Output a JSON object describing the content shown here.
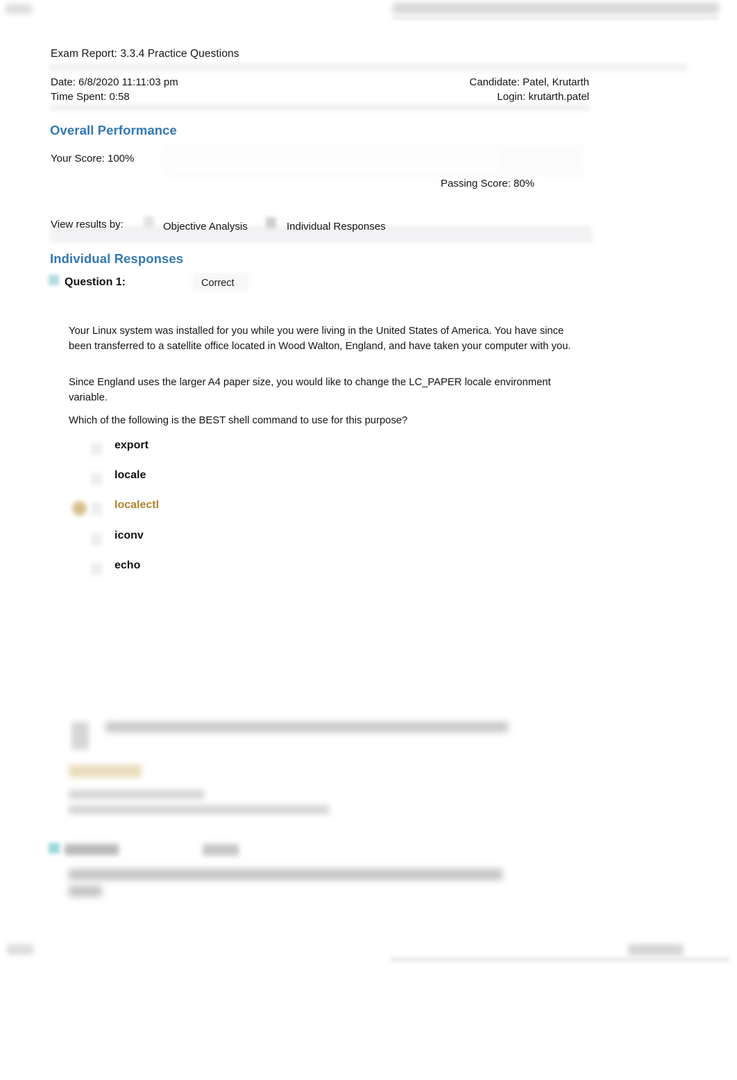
{
  "document": {
    "title": "Exam Report: 3.3.4 Practice Questions"
  },
  "meta": {
    "date_label": "Date: 6/8/2020 11:11:03 pm",
    "time_spent_label": "Time Spent: 0:58",
    "candidate_label": "Candidate: Patel, Krutarth",
    "login_label": "Login: krutarth.patel"
  },
  "overall_performance": {
    "heading": "Overall Performance",
    "your_score_label": "Your Score:  100%",
    "your_score_value": "100%",
    "passing_score_label": "Passing Score:  80%",
    "passing_score_value": "80%"
  },
  "view_results": {
    "label": "View results by:",
    "options": [
      {
        "label": "Objective Analysis",
        "selected": false
      },
      {
        "label": "Individual Responses",
        "selected": true
      }
    ]
  },
  "individual_responses": {
    "heading": "Individual Responses",
    "question": {
      "number_label": "Question 1:",
      "status_label": "Correct",
      "paragraphs": [
        "Your Linux system was installed for you while you were living in the United States of America. You have since been transferred to a satellite office located in Wood Walton, England, and have taken your computer with you.",
        "Since England uses the larger A4 paper size, you would like to change the LC_PAPER locale environment variable.",
        "Which of the following is the BEST shell command to use for this purpose?"
      ],
      "options": [
        {
          "label": "export",
          "selected": false
        },
        {
          "label": "locale",
          "selected": false
        },
        {
          "label": "localectl",
          "selected": true
        },
        {
          "label": "iconv",
          "selected": false
        },
        {
          "label": "echo",
          "selected": false
        }
      ]
    }
  },
  "colors": {
    "heading_blue": "#3278b4",
    "selected_answer_gold": "#b0842f",
    "correct_icon_teal": "#9fd6da",
    "selected_marker_gold": "#cdb072"
  }
}
